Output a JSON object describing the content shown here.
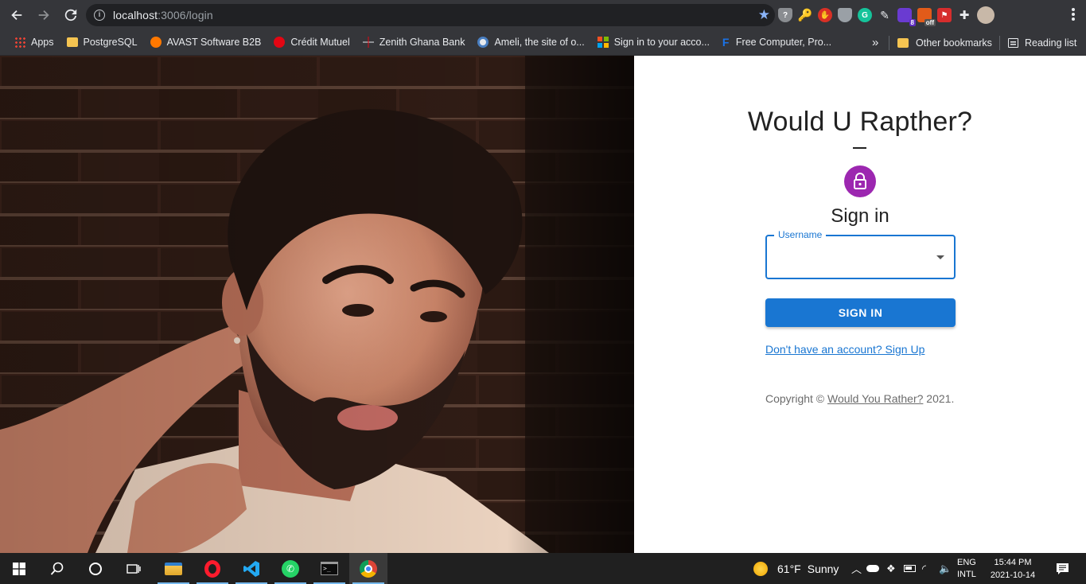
{
  "browser": {
    "url_host": "localhost",
    "url_path": ":3006/login"
  },
  "bookmarks": {
    "items": [
      {
        "label": "Apps",
        "icon": "apps-grid-icon",
        "color": "#e8453c"
      },
      {
        "label": "PostgreSQL",
        "icon": "folder-icon",
        "color": "#f5c451"
      },
      {
        "label": "AVAST Software B2B",
        "icon": "avast-icon",
        "color": "#ff7800"
      },
      {
        "label": "Crédit Mutuel",
        "icon": "credit-mutuel-icon",
        "color": "#e30613"
      },
      {
        "label": "Zenith Ghana Bank",
        "icon": "zenith-icon",
        "color": "#e30613"
      },
      {
        "label": "Ameli, the site of o...",
        "icon": "ameli-icon",
        "color": "#4a7fc1"
      },
      {
        "label": "Sign in to your acco...",
        "icon": "microsoft-icon",
        "color": "#f25022"
      },
      {
        "label": "Free Computer, Pro...",
        "icon": "f-icon",
        "color": "#1a73e8"
      }
    ],
    "overflow_label": "»",
    "other_bookmarks": "Other bookmarks",
    "reading_list": "Reading list"
  },
  "login": {
    "app_title": "Would U Rapther?",
    "heading": "Sign in",
    "username_label": "Username",
    "username_value": "",
    "submit_label": "SIGN IN",
    "signup_link": "Don't have an account? Sign Up",
    "copyright_prefix": "Copyright © ",
    "copyright_link": "Would You Rather?",
    "copyright_suffix": " 2021.",
    "accent_color": "#1976d2",
    "avatar_color": "#9c27b0"
  },
  "taskbar": {
    "weather_temp": "61°F",
    "weather_text": "Sunny",
    "lang_top": "ENG",
    "lang_bottom": "INTL",
    "time": "15:44 PM",
    "date": "2021-10-14"
  },
  "extensions": {
    "badge_count": "8",
    "off_label": "off"
  }
}
